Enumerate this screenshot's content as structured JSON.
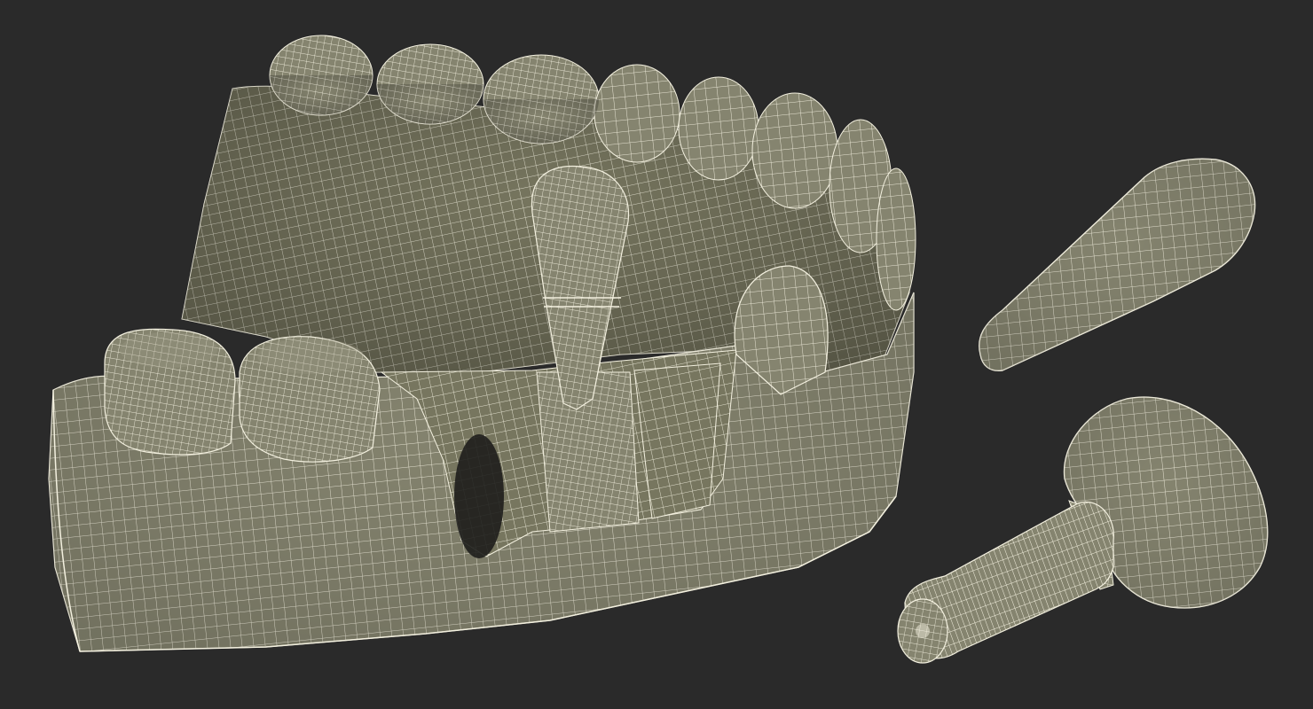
{
  "scene": {
    "background_color": "#2a2a2a",
    "mesh_fill_color": "#85846f",
    "mesh_shadow_color": "#5f5e50",
    "wire_color": "#f3f0df",
    "objects": [
      {
        "name": "lower-jaw-model",
        "kind": "mesh"
      },
      {
        "name": "tooth-root-crown",
        "kind": "mesh"
      },
      {
        "name": "dental-implant-screw",
        "kind": "mesh"
      }
    ]
  }
}
